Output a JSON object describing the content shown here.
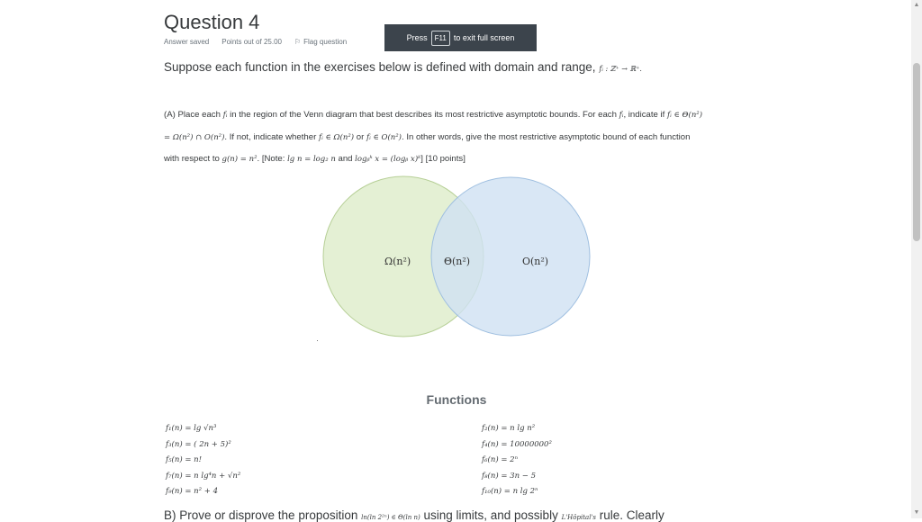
{
  "question": {
    "title": "Question 4",
    "status": "Answer saved",
    "points": "Points out of 25.00",
    "flag_label": "Flag question"
  },
  "fullscreen_banner": {
    "prefix": "Press",
    "key": "F11",
    "suffix": "to exit full screen"
  },
  "intro": {
    "text": "Suppose each function in the exercises below is defined with domain and range,",
    "math": "fᵢ : ℤ⁺ → ℝ⁺."
  },
  "partA": {
    "l1_a": "(A) Place each ",
    "l1_m1": "fᵢ",
    "l1_b": " in the region of the Venn diagram that best describes its most restrictive asymptotic bounds. For each ",
    "l1_m2": "fᵢ",
    "l1_c": ", indicate if ",
    "l1_m3": "fᵢ ∈ Θ(n²)",
    "l2_m1": "= Ω(n²) ∩ O(n²)",
    "l2_a": ". If not, indicate whether ",
    "l2_m2": "fᵢ ∈ Ω(n²)",
    "l2_b": " or ",
    "l2_m3": "fᵢ ∈ O(n²)",
    "l2_c": ". In other words, give the most restrictive asymptotic bound of each function",
    "l3_a": "with respect to ",
    "l3_m1": "g(n) = n²",
    "l3_b": ". [Note: ",
    "l3_m2": "lg n = log₂ n",
    "l3_c": " and ",
    "l3_m3": "logᵦᵏ x = (logᵦ x)ᵏ",
    "l3_d": "] [10 points]"
  },
  "venn": {
    "left_label": "Ω(n²)",
    "center_label": "Θ(n²)",
    "right_label": "O(n²)",
    "left_color": "#dfedcc",
    "right_color": "#cfe1f3"
  },
  "functions": {
    "title": "Functions",
    "left": [
      "f₁(n) = lg √n³",
      "f₃(n) = ( 2n + 5)²",
      "f₅(n) = n!",
      "f₇(n) = n lg⁴n + √n²",
      "f₉(n) = n² + 4"
    ],
    "right": [
      "f₂(n) = n lg n²",
      "f₄(n) = 10000000²",
      "f₆(n) = 2ⁿ",
      "f₈(n) = 3n − 5",
      "f₁₀(n) = n lg 2ⁿ"
    ]
  },
  "partB": {
    "a": "B) Prove or disprove the proposition",
    "m": "ln(ln 2²ⁿ) ∈ Θ(ln n)",
    "b": "using limits, and possibly",
    "m2": "L'Hôpital's",
    "c": "rule. Clearly"
  }
}
